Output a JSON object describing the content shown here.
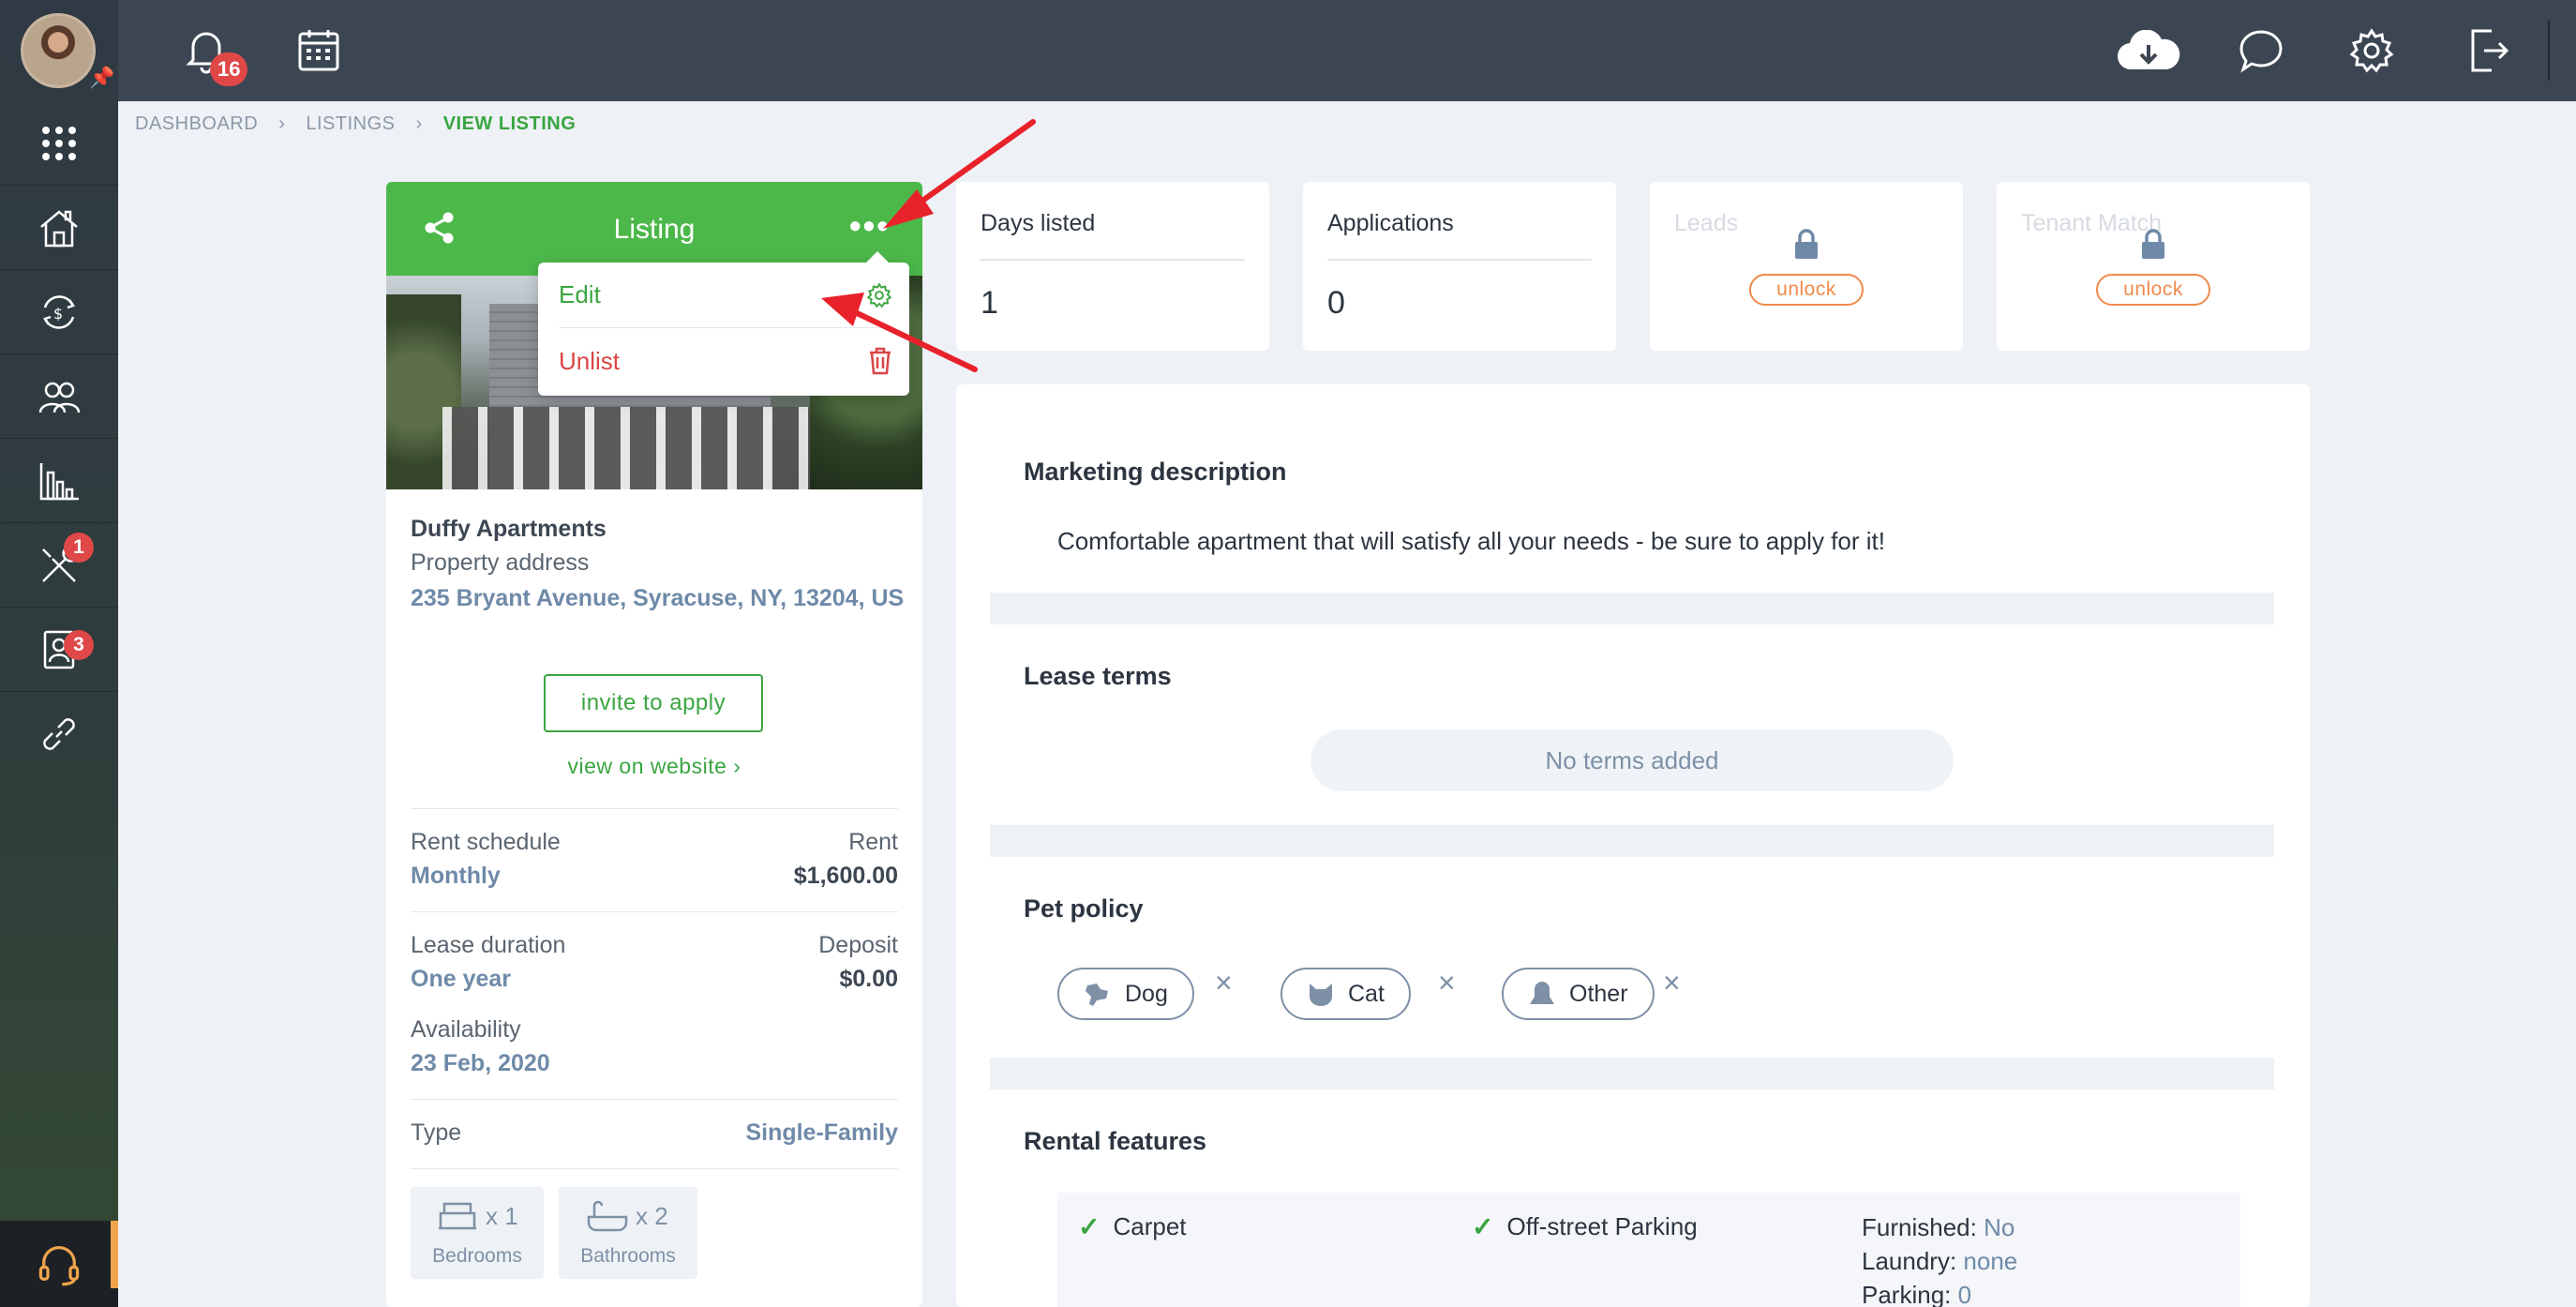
{
  "sidebar": {
    "badges": {
      "tools": "1",
      "applications": "3"
    }
  },
  "topbar": {
    "notifications_count": "16"
  },
  "breadcrumb": {
    "items": [
      "DASHBOARD",
      "LISTINGS",
      "VIEW LISTING"
    ]
  },
  "listing": {
    "title": "Listing",
    "menu": {
      "edit": "Edit",
      "unlist": "Unlist"
    },
    "property_name": "Duffy Apartments",
    "property_address_label": "Property address",
    "property_address": "235 Bryant Avenue, Syracuse, NY, 13204, US",
    "invite_button": "invite to apply",
    "view_link": "view on website ›",
    "rent_schedule_label": "Rent schedule",
    "rent_schedule_value": "Monthly",
    "rent_label": "Rent",
    "rent_value": "$1,600.00",
    "lease_duration_label": "Lease duration",
    "lease_duration_value": "One year",
    "deposit_label": "Deposit",
    "deposit_value": "$0.00",
    "availability_label": "Availability",
    "availability_value": "23 Feb, 2020",
    "type_label": "Type",
    "type_value": "Single-Family",
    "bedrooms_count": "x 1",
    "bedrooms_label": "Bedrooms",
    "bathrooms_count": "x 2",
    "bathrooms_label": "Bathrooms"
  },
  "stats": {
    "days_listed_label": "Days listed",
    "days_listed_value": "1",
    "applications_label": "Applications",
    "applications_value": "0",
    "leads_label": "Leads",
    "tenant_match_label": "Tenant Match",
    "unlock_label": "unlock"
  },
  "main": {
    "marketing_title": "Marketing description",
    "marketing_text": "Comfortable apartment that will satisfy all your needs - be sure to apply for it!",
    "lease_terms_title": "Lease terms",
    "no_terms": "No terms added",
    "pet_policy_title": "Pet policy",
    "pets": [
      "Dog",
      "Cat",
      "Other"
    ],
    "rental_features_title": "Rental features",
    "features": [
      "Carpet",
      "Off-street Parking"
    ],
    "furnished_label": "Furnished:",
    "furnished_value": "No",
    "laundry_label": "Laundry:",
    "laundry_value": "none",
    "parking_label": "Parking:",
    "parking_value": "0"
  },
  "colors": {
    "accent_green": "#4cb84a",
    "danger_red": "#d94545",
    "unlock_orange": "#f08a4a",
    "annotation_arrow": "#e8222a"
  }
}
